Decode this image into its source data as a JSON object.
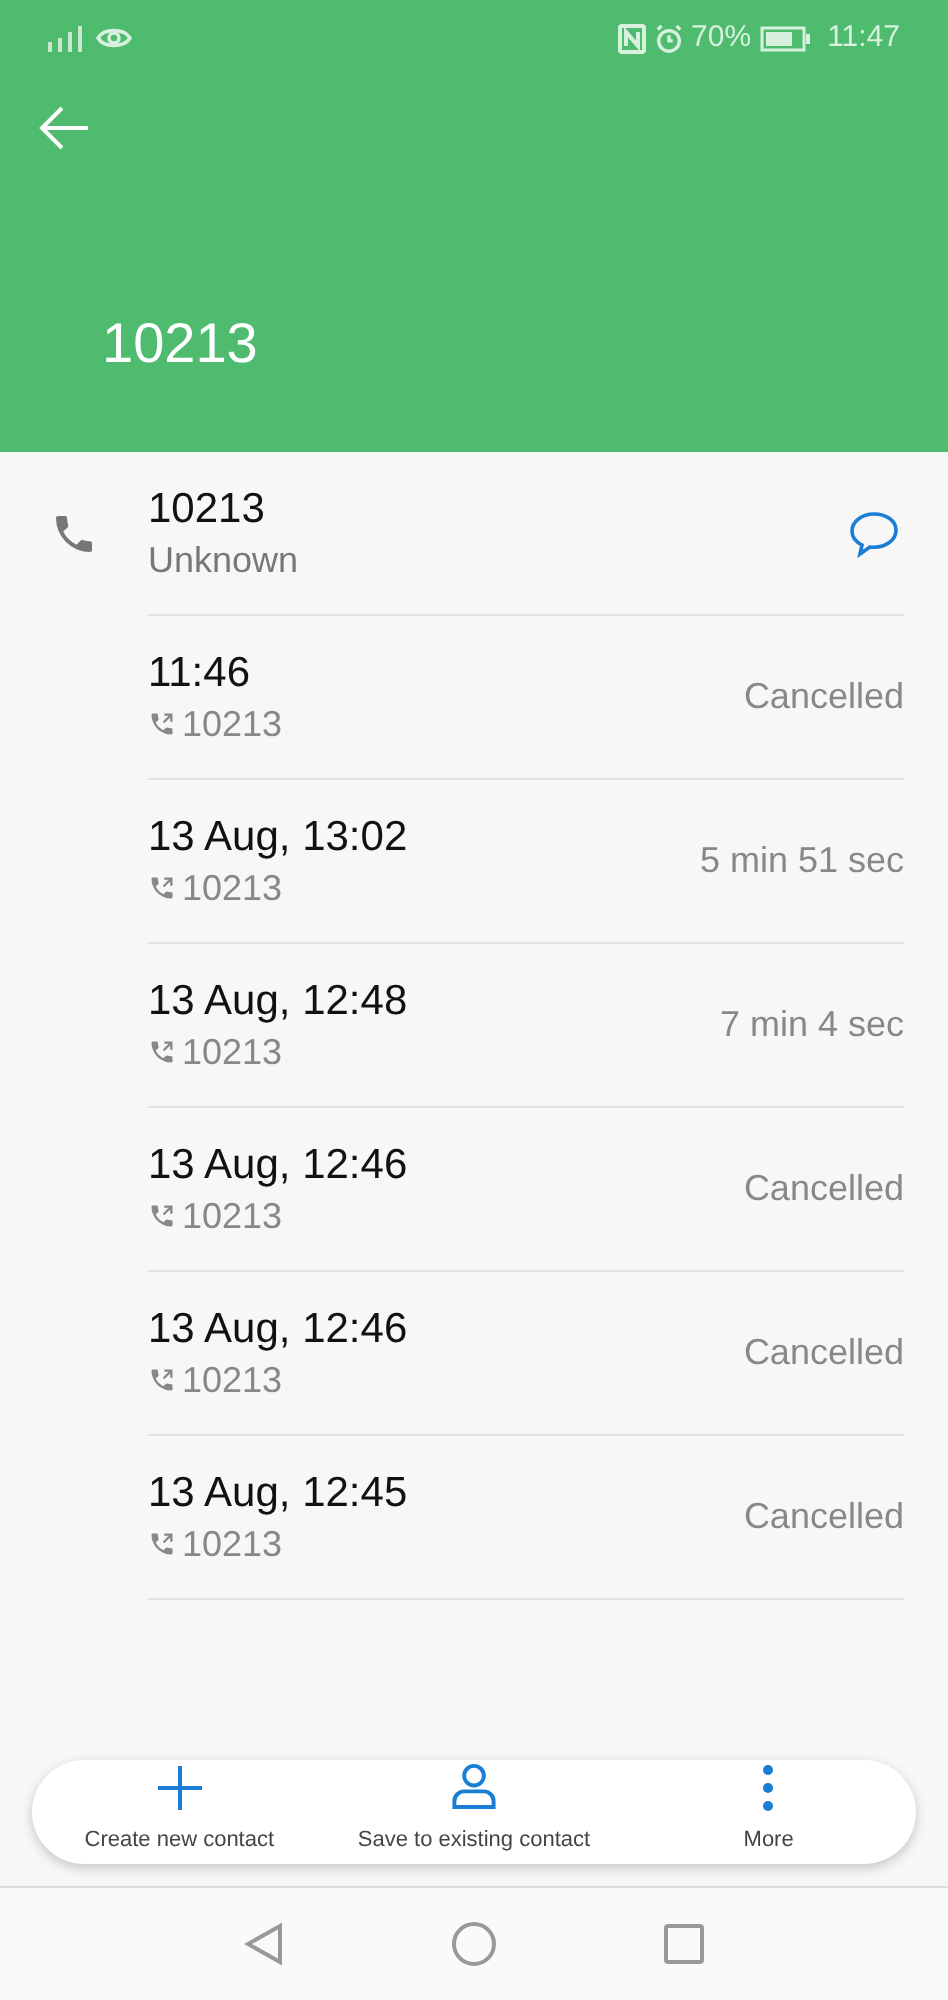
{
  "status_bar": {
    "battery": "70%",
    "time": "11:47"
  },
  "header": {
    "title": "10213"
  },
  "contact": {
    "number": "10213",
    "label": "Unknown"
  },
  "calls": [
    {
      "time": "11:46",
      "number": "10213",
      "result": "Cancelled"
    },
    {
      "time": "13 Aug, 13:02",
      "number": "10213",
      "result": "5 min 51 sec"
    },
    {
      "time": "13 Aug, 12:48",
      "number": "10213",
      "result": "7 min 4 sec"
    },
    {
      "time": "13 Aug, 12:46",
      "number": "10213",
      "result": "Cancelled"
    },
    {
      "time": "13 Aug, 12:46",
      "number": "10213",
      "result": "Cancelled"
    },
    {
      "time": "13 Aug, 12:45",
      "number": "10213",
      "result": "Cancelled"
    }
  ],
  "actions": [
    {
      "kind": "add",
      "label": "Create new contact"
    },
    {
      "kind": "person",
      "label": "Save to existing contact"
    },
    {
      "kind": "more",
      "label": "More"
    }
  ]
}
